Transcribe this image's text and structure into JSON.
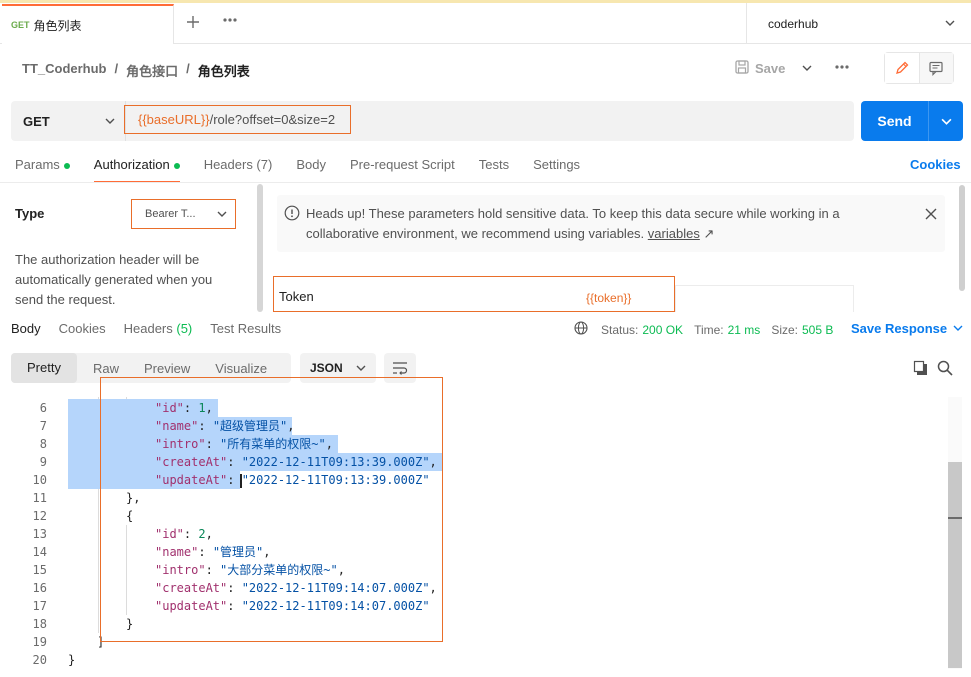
{
  "tab": {
    "method": "GET",
    "title": "角色列表"
  },
  "environment": {
    "name": "coderhub"
  },
  "breadcrumb": {
    "collection": "TT_Coderhub",
    "folder": "角色接口",
    "request": "角色列表"
  },
  "toolbar": {
    "save_label": "Save"
  },
  "request": {
    "method": "GET",
    "url_variable": "{{baseURL}}",
    "url_path": "/role?offset=0&size=2",
    "send_label": "Send"
  },
  "request_tabs": [
    {
      "label": "Params",
      "dot": true
    },
    {
      "label": "Authorization",
      "dot": true
    },
    {
      "label": "Headers (7)"
    },
    {
      "label": "Body"
    },
    {
      "label": "Pre-request Script"
    },
    {
      "label": "Tests"
    },
    {
      "label": "Settings"
    }
  ],
  "cookies_label": "Cookies",
  "auth": {
    "type_label": "Type",
    "type_value": "Bearer T...",
    "description": "The authorization header will be automatically generated when you send the request.",
    "alert_text": "Heads up! These parameters hold sensitive data. To keep this data secure while working in a collaborative environment, we recommend using variables.",
    "alert_link": "variables",
    "token_label": "Token",
    "token_value": "{{token}}"
  },
  "response_tabs": [
    {
      "label": "Body",
      "count": ""
    },
    {
      "label": "Cookies",
      "count": ""
    },
    {
      "label": "Headers",
      "count": "(5)"
    },
    {
      "label": "Test Results",
      "count": ""
    }
  ],
  "response_meta": {
    "status_label": "Status:",
    "status_value": "200 OK",
    "time_label": "Time:",
    "time_value": "21 ms",
    "size_label": "Size:",
    "size_value": "505 B",
    "save_response_label": "Save Response"
  },
  "viewer": {
    "tabs": [
      "Pretty",
      "Raw",
      "Preview",
      "Visualize"
    ],
    "format": "JSON"
  },
  "code_lines": [
    {
      "n": "6",
      "indent": 3,
      "key": "id",
      "val": "1",
      "type": "num",
      "trail": ","
    },
    {
      "n": "7",
      "indent": 3,
      "key": "name",
      "val": "超级管理员",
      "type": "str",
      "trail": ","
    },
    {
      "n": "8",
      "indent": 3,
      "key": "intro",
      "val": "所有菜单的权限~",
      "type": "str",
      "trail": ","
    },
    {
      "n": "9",
      "indent": 3,
      "key": "createAt",
      "val": "2022-12-11T09:13:39.000Z",
      "type": "str",
      "trail": ","
    },
    {
      "n": "10",
      "indent": 3,
      "key": "updateAt",
      "val": "2022-12-11T09:13:39.000Z",
      "type": "str",
      "trail": ""
    },
    {
      "n": "11",
      "indent": 2,
      "raw": "},"
    },
    {
      "n": "12",
      "indent": 2,
      "raw": "{"
    },
    {
      "n": "13",
      "indent": 3,
      "key": "id",
      "val": "2",
      "type": "num",
      "trail": ","
    },
    {
      "n": "14",
      "indent": 3,
      "key": "name",
      "val": "管理员",
      "type": "str",
      "trail": ","
    },
    {
      "n": "15",
      "indent": 3,
      "key": "intro",
      "val": "大部分菜单的权限~",
      "type": "str",
      "trail": ","
    },
    {
      "n": "16",
      "indent": 3,
      "key": "createAt",
      "val": "2022-12-11T09:14:07.000Z",
      "type": "str",
      "trail": ","
    },
    {
      "n": "17",
      "indent": 3,
      "key": "updateAt",
      "val": "2022-12-11T09:14:07.000Z",
      "type": "str",
      "trail": ""
    },
    {
      "n": "18",
      "indent": 2,
      "raw": "}"
    },
    {
      "n": "19",
      "indent": 1,
      "raw": "]"
    },
    {
      "n": "20",
      "indent": 0,
      "raw": "}"
    }
  ],
  "colors": {
    "accent": "#ff6c37",
    "primary": "#097bed",
    "success": "#0cbb52",
    "annotation": "#e96e2a",
    "selection": "#b5d5fb"
  },
  "icons": [
    "plus-icon",
    "more-icon",
    "chevron-down-icon",
    "save-icon",
    "pencil-icon",
    "comment-icon",
    "info-icon",
    "close-icon",
    "globe-icon",
    "wrap-icon",
    "copy-icon",
    "search-icon"
  ]
}
